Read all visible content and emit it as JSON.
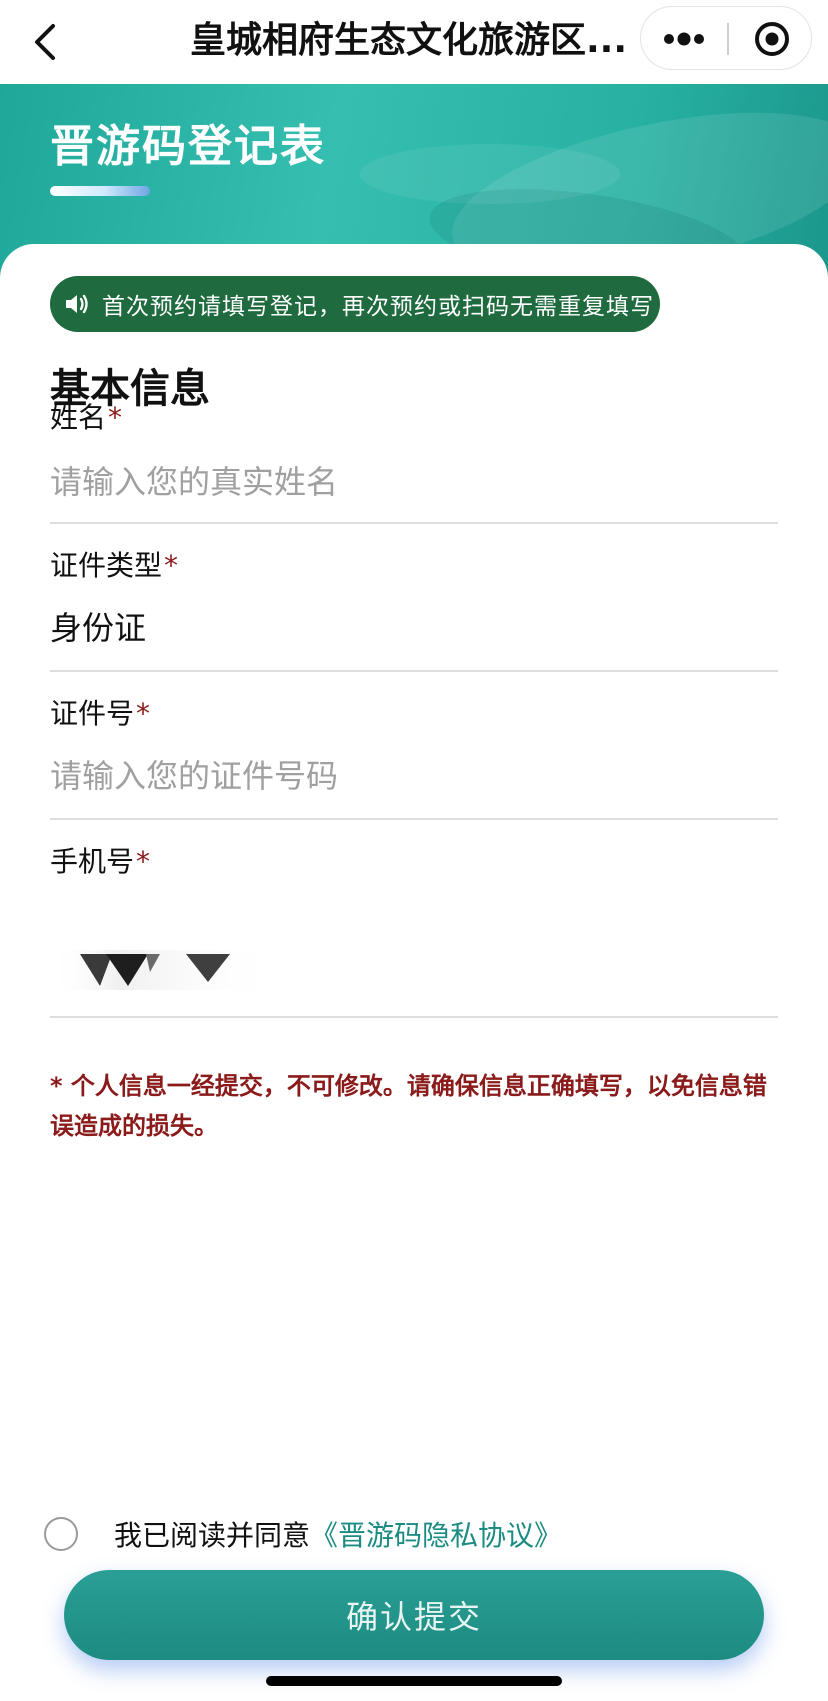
{
  "navbar": {
    "title": "皇城相府生态文化旅游区...",
    "back_icon": "chevron-left-icon",
    "more_icon": "more-dots-icon",
    "close_icon": "miniprogram-close-icon"
  },
  "banner": {
    "title": "晋游码登记表"
  },
  "notice": {
    "icon": "speaker-icon",
    "text": "首次预约请填写登记，再次预约或扫码无需重复填写"
  },
  "section": {
    "title": "基本信息"
  },
  "form": {
    "required_mark": "*",
    "name": {
      "label": "姓名",
      "placeholder": "请输入您的真实姓名"
    },
    "id_type": {
      "label": "证件类型",
      "value": "身份证"
    },
    "id_number": {
      "label": "证件号",
      "placeholder": "请输入您的证件号码"
    },
    "phone": {
      "label": "手机号"
    }
  },
  "warning": "* 个人信息一经提交，不可修改。请确保信息正确填写，以免信息错误造成的损失。",
  "agreement": {
    "text": "我已阅读并同意",
    "link": "《晋游码隐私协议》"
  },
  "submit_label": "确认提交",
  "colors": {
    "accent": "#1d8b80",
    "notice_bg": "#1f6b3f",
    "warning": "#8b1a1a",
    "link": "#1c8c83"
  }
}
